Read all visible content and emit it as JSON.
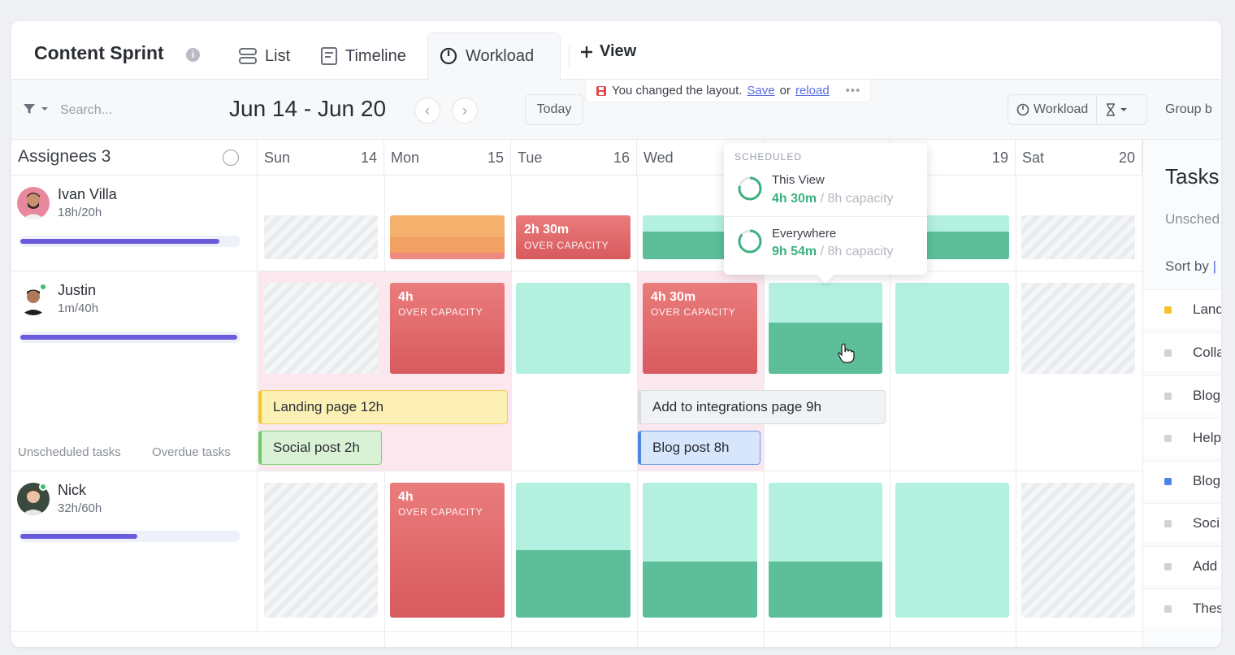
{
  "header": {
    "title": "Content Sprint",
    "info": "i",
    "tabs": [
      {
        "label": "List"
      },
      {
        "label": "Timeline"
      },
      {
        "label": "Workload"
      }
    ],
    "add_view": "View"
  },
  "toolbar": {
    "search_placeholder": "Search...",
    "date_range": "Jun 14 - Jun 20",
    "today": "Today",
    "notice": {
      "text": "You changed the layout.",
      "save": "Save",
      "or": "or",
      "reload": "reload",
      "more": "•••"
    },
    "workload": "Workload",
    "group_by": "Group b"
  },
  "grid": {
    "assignees_label": "Assignees 3",
    "days": [
      {
        "day": "Sun",
        "num": "14"
      },
      {
        "day": "Mon",
        "num": "15"
      },
      {
        "day": "Tue",
        "num": "16"
      },
      {
        "day": "Wed",
        "num": ""
      },
      {
        "day": "",
        "num": ""
      },
      {
        "day": "",
        "num": "19"
      },
      {
        "day": "Sat",
        "num": "20"
      }
    ],
    "people": [
      {
        "name": "Ivan Villa",
        "hours": "18h/20h",
        "progress": 0.9
      },
      {
        "name": "Justin",
        "hours": "1m/40h",
        "progress": 0.98
      },
      {
        "name": "Nick",
        "hours": "32h/60h",
        "progress": 0.53
      }
    ],
    "ivan_tue": {
      "hours": "2h 30m",
      "label": "OVER CAPACITY"
    },
    "justin_mon": {
      "hours": "4h",
      "label": "OVER CAPACITY"
    },
    "justin_wed": {
      "hours": "4h 30m",
      "label": "OVER CAPACITY"
    },
    "nick_mon": {
      "hours": "4h",
      "label": "OVER CAPACITY"
    },
    "tasks": {
      "landing": "Landing page 12h",
      "social": "Social post 2h",
      "integrations": "Add to integrations page 9h",
      "blog": "Blog post 8h"
    },
    "unscheduled_tasks": "Unscheduled tasks",
    "overdue_tasks": "Overdue tasks"
  },
  "tooltip": {
    "header": "SCHEDULED",
    "items": [
      {
        "label": "This View",
        "value": "4h 30m",
        "capacity": "/ 8h capacity"
      },
      {
        "label": "Everywhere",
        "value": "9h 54m",
        "capacity": "/ 8h capacity"
      }
    ]
  },
  "side": {
    "title": "Tasks",
    "unscheduled": "Unsched",
    "sort_by": "Sort by",
    "items": [
      {
        "text": "Land",
        "color": "#f5c32a"
      },
      {
        "text": "Colla",
        "color": "#d0d3d8"
      },
      {
        "text": "Blog",
        "color": "#d0d3d8"
      },
      {
        "text": "Help",
        "color": "#d0d3d8"
      },
      {
        "text": "Blog",
        "color": "#4c84e6"
      },
      {
        "text": "Soci",
        "color": "#d0d3d8"
      },
      {
        "text": "Add",
        "color": "#d0d3d8"
      },
      {
        "text": "Thes",
        "color": "#d0d3d8"
      }
    ]
  },
  "colors": {
    "accent": "#6a5bdc",
    "over_capacity": "#d85a5e",
    "available": "#b3f0df",
    "scheduled": "#5cbf99"
  }
}
